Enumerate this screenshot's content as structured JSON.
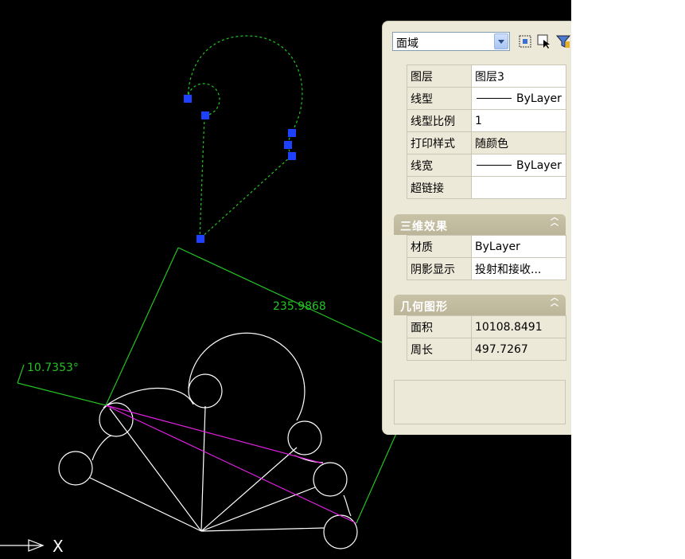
{
  "canvas": {
    "dimension_length": "235.9868",
    "dimension_angle": "10.7353°",
    "ucs_axis_label": "X"
  },
  "properties_panel": {
    "object_type": "面域",
    "toolbar_icons": [
      "quick-select-icon",
      "select-objects-icon",
      "filter-icon"
    ],
    "general": [
      {
        "key": "图层",
        "value": "图层3"
      },
      {
        "key": "线型",
        "value": "ByLayer",
        "linetype_sample": true
      },
      {
        "key": "线型比例",
        "value": "1"
      },
      {
        "key": "打印样式",
        "value": "随颜色"
      },
      {
        "key": "线宽",
        "value": "ByLayer",
        "linetype_sample": true
      },
      {
        "key": "超链接",
        "value": ""
      }
    ],
    "section_3d": {
      "title": "三维效果",
      "rows": [
        {
          "key": "材质",
          "value": "ByLayer"
        },
        {
          "key": "阴影显示",
          "value": "投射和接收..."
        }
      ]
    },
    "section_geometry": {
      "title": "几何图形",
      "rows": [
        {
          "key": "面积",
          "value": "10108.8491"
        },
        {
          "key": "周长",
          "value": "497.7267"
        }
      ]
    }
  },
  "colors": {
    "canvas_bg": "#000000",
    "drawing_lines": "#ffffff",
    "dimension_green": "#22c322",
    "selection_dashed": "#22c322",
    "grips": "#1e40ff",
    "construction_magenta": "#e020e0",
    "panel_bg": "#ece9d8",
    "section_header": "#c2bca0"
  }
}
